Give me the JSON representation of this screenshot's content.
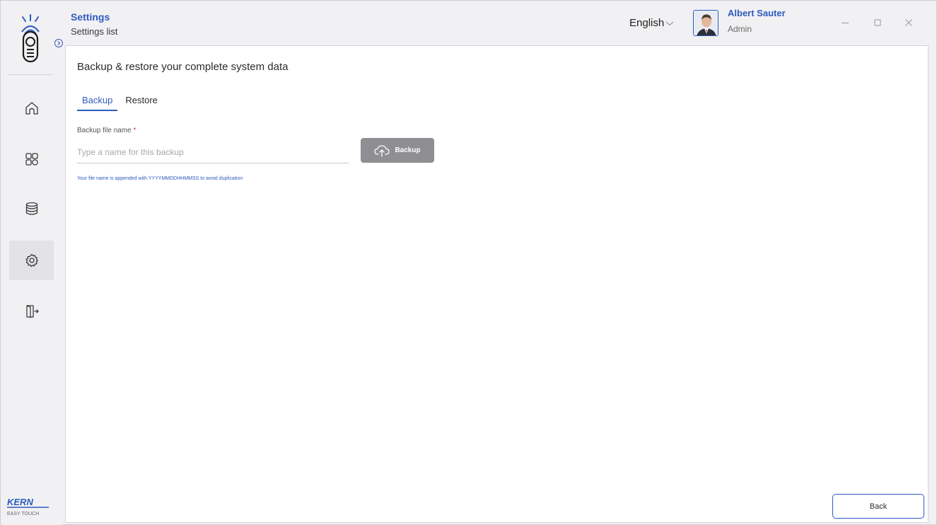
{
  "header": {
    "title": "Settings",
    "subtitle": "Settings list",
    "language": "English",
    "user_name": "Albert Sauter",
    "user_role": "Admin"
  },
  "sidebar": {
    "items": [
      {
        "name": "home",
        "icon": "home-icon"
      },
      {
        "name": "dashboard",
        "icon": "grid-icon"
      },
      {
        "name": "database",
        "icon": "database-icon"
      },
      {
        "name": "settings",
        "icon": "gear-icon",
        "active": true
      },
      {
        "name": "logout",
        "icon": "exit-icon"
      }
    ],
    "brand": "KERN",
    "brand_sub": "EASY TOUCH"
  },
  "main": {
    "heading": "Backup & restore your complete system data",
    "tabs": [
      {
        "label": "Backup",
        "active": true
      },
      {
        "label": "Restore",
        "active": false
      }
    ],
    "field_label": "Backup file name",
    "field_required_mark": "*",
    "field_placeholder": "Type a name for this backup",
    "field_value": "",
    "backup_button": "Backup",
    "hint": "Your file name is appended with YYYYMMDDHHMMSS to avoid duplication",
    "back_button": "Back"
  },
  "colors": {
    "accent": "#2d5bbf",
    "button_disabled": "#8f8f93",
    "required": "#d23b3b"
  }
}
